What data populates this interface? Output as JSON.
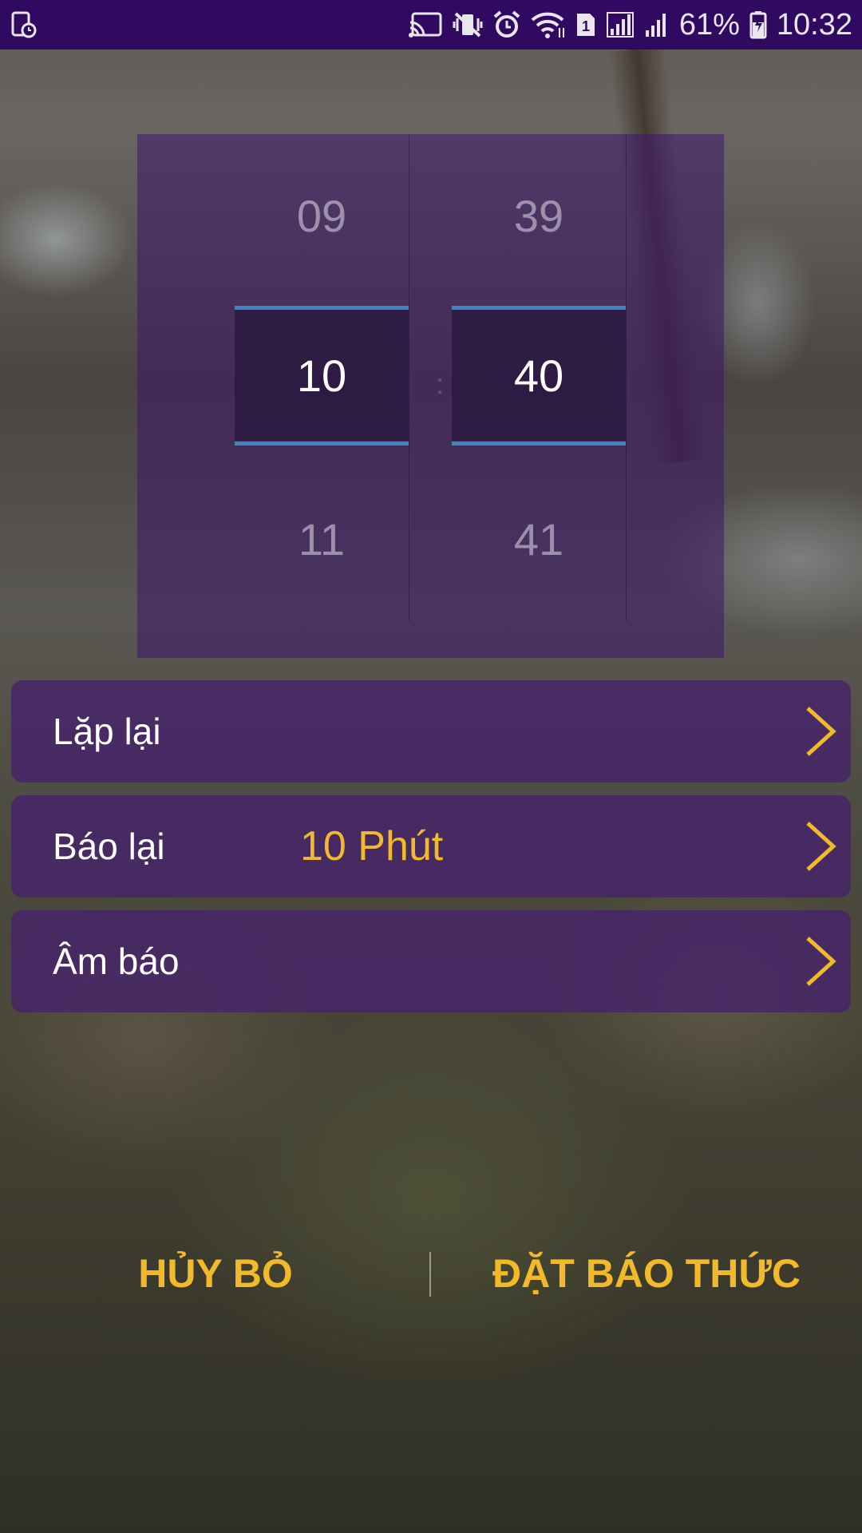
{
  "status_bar": {
    "battery_percent": "61%",
    "time": "10:32",
    "sim_slot": "1",
    "icons": [
      "screen-record-icon",
      "cast-icon",
      "vibrate-mute-icon",
      "alarm-icon",
      "wifi-icon",
      "sim-icon",
      "signal-icon",
      "signal-icon",
      "battery-charging-icon"
    ]
  },
  "time_picker": {
    "hours": {
      "prev": "09",
      "current": "10",
      "next": "11"
    },
    "minutes": {
      "prev": "39",
      "current": "40",
      "next": "41"
    },
    "separator": ":"
  },
  "settings": {
    "repeat": {
      "label": "Lặp lại"
    },
    "snooze": {
      "label": "Báo lại",
      "value": "10 Phút"
    },
    "sound": {
      "label": "Âm báo"
    }
  },
  "actions": {
    "cancel": "HỦY BỎ",
    "set_alarm": "ĐẶT BÁO THỨC"
  },
  "colors": {
    "status_bar": "#2f0a60",
    "accent": "#f2b92b",
    "selection_line": "#3d86c6"
  }
}
